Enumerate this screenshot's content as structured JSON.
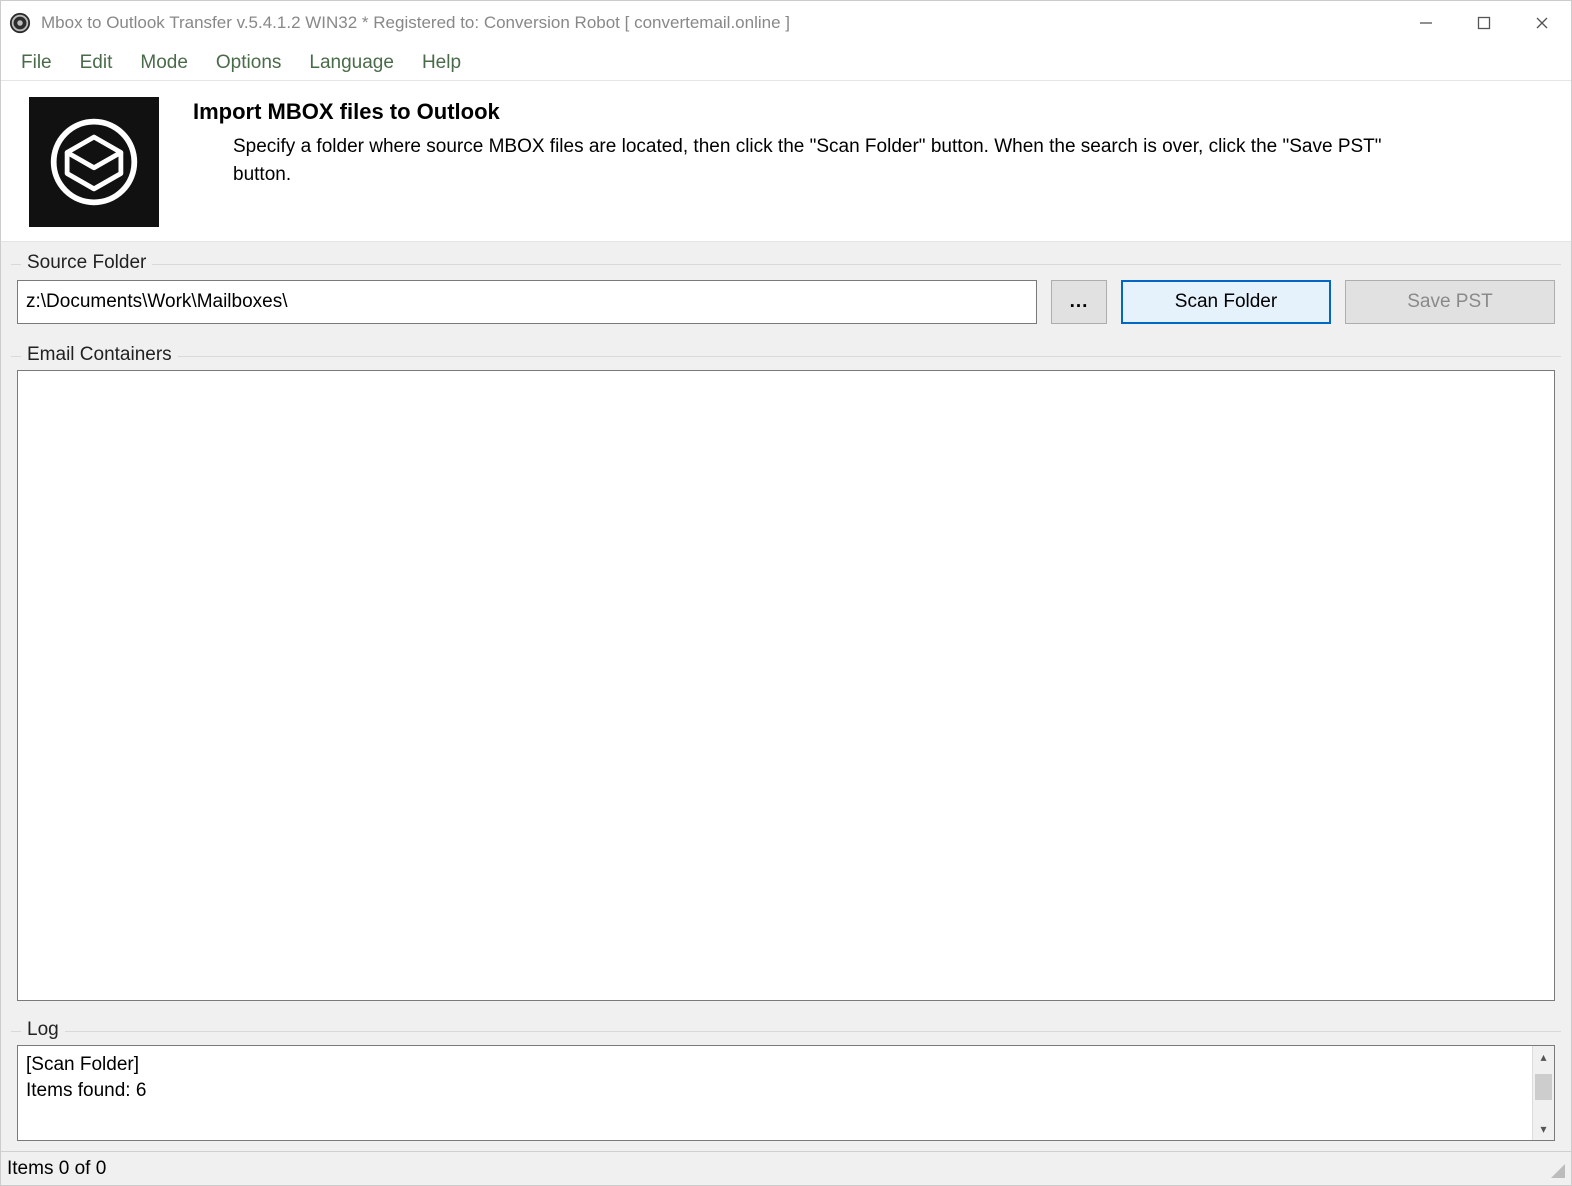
{
  "titlebar": {
    "title": "Mbox to Outlook Transfer v.5.4.1.2 WIN32 * Registered to: Conversion Robot [ convertemail.online ]"
  },
  "menu": {
    "items": [
      "File",
      "Edit",
      "Mode",
      "Options",
      "Language",
      "Help"
    ]
  },
  "header": {
    "title": "Import MBOX files to Outlook",
    "description": "Specify a folder where source MBOX files are located, then click the \"Scan Folder\" button. When the search is over, click the \"Save PST\" button."
  },
  "source": {
    "group_label": "Source Folder",
    "path": "z:\\Documents\\Work\\Mailboxes\\",
    "browse_label": "...",
    "scan_label": "Scan Folder",
    "save_label": "Save PST"
  },
  "containers": {
    "group_label": "Email Containers"
  },
  "log": {
    "group_label": "Log",
    "lines": [
      "[Scan Folder]",
      "Items found: 6"
    ]
  },
  "status": {
    "text": "Items 0 of 0"
  }
}
